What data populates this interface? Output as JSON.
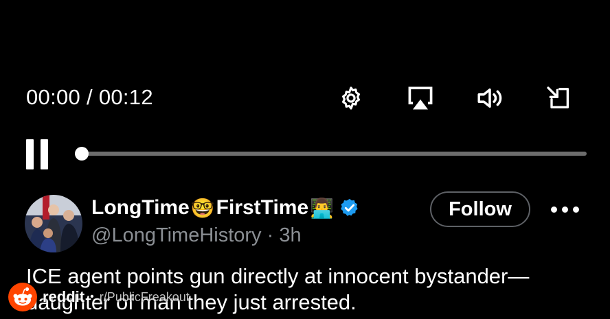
{
  "player": {
    "time_display": "00:00 / 00:12",
    "progress": 0.0,
    "controls": [
      "settings-gear",
      "airplay",
      "volume",
      "exit-fullscreen"
    ]
  },
  "post": {
    "display_name_part1": "LongTime",
    "display_name_emoji1": "🤓",
    "display_name_part2": "FirstTime",
    "display_name_emoji2": "👨‍💻",
    "verified_color": "#1d9bf0",
    "handle": "@LongTimeHistory",
    "separator": " · ",
    "age": "3h",
    "follow_label": "Follow",
    "text": "ICE agent points gun directly at innocent bystander—daughter of man they just arrested."
  },
  "watermark": {
    "brand": "reddit",
    "separator": "•",
    "subreddit": "r/PublicFreakout",
    "color": "#ff4500"
  }
}
